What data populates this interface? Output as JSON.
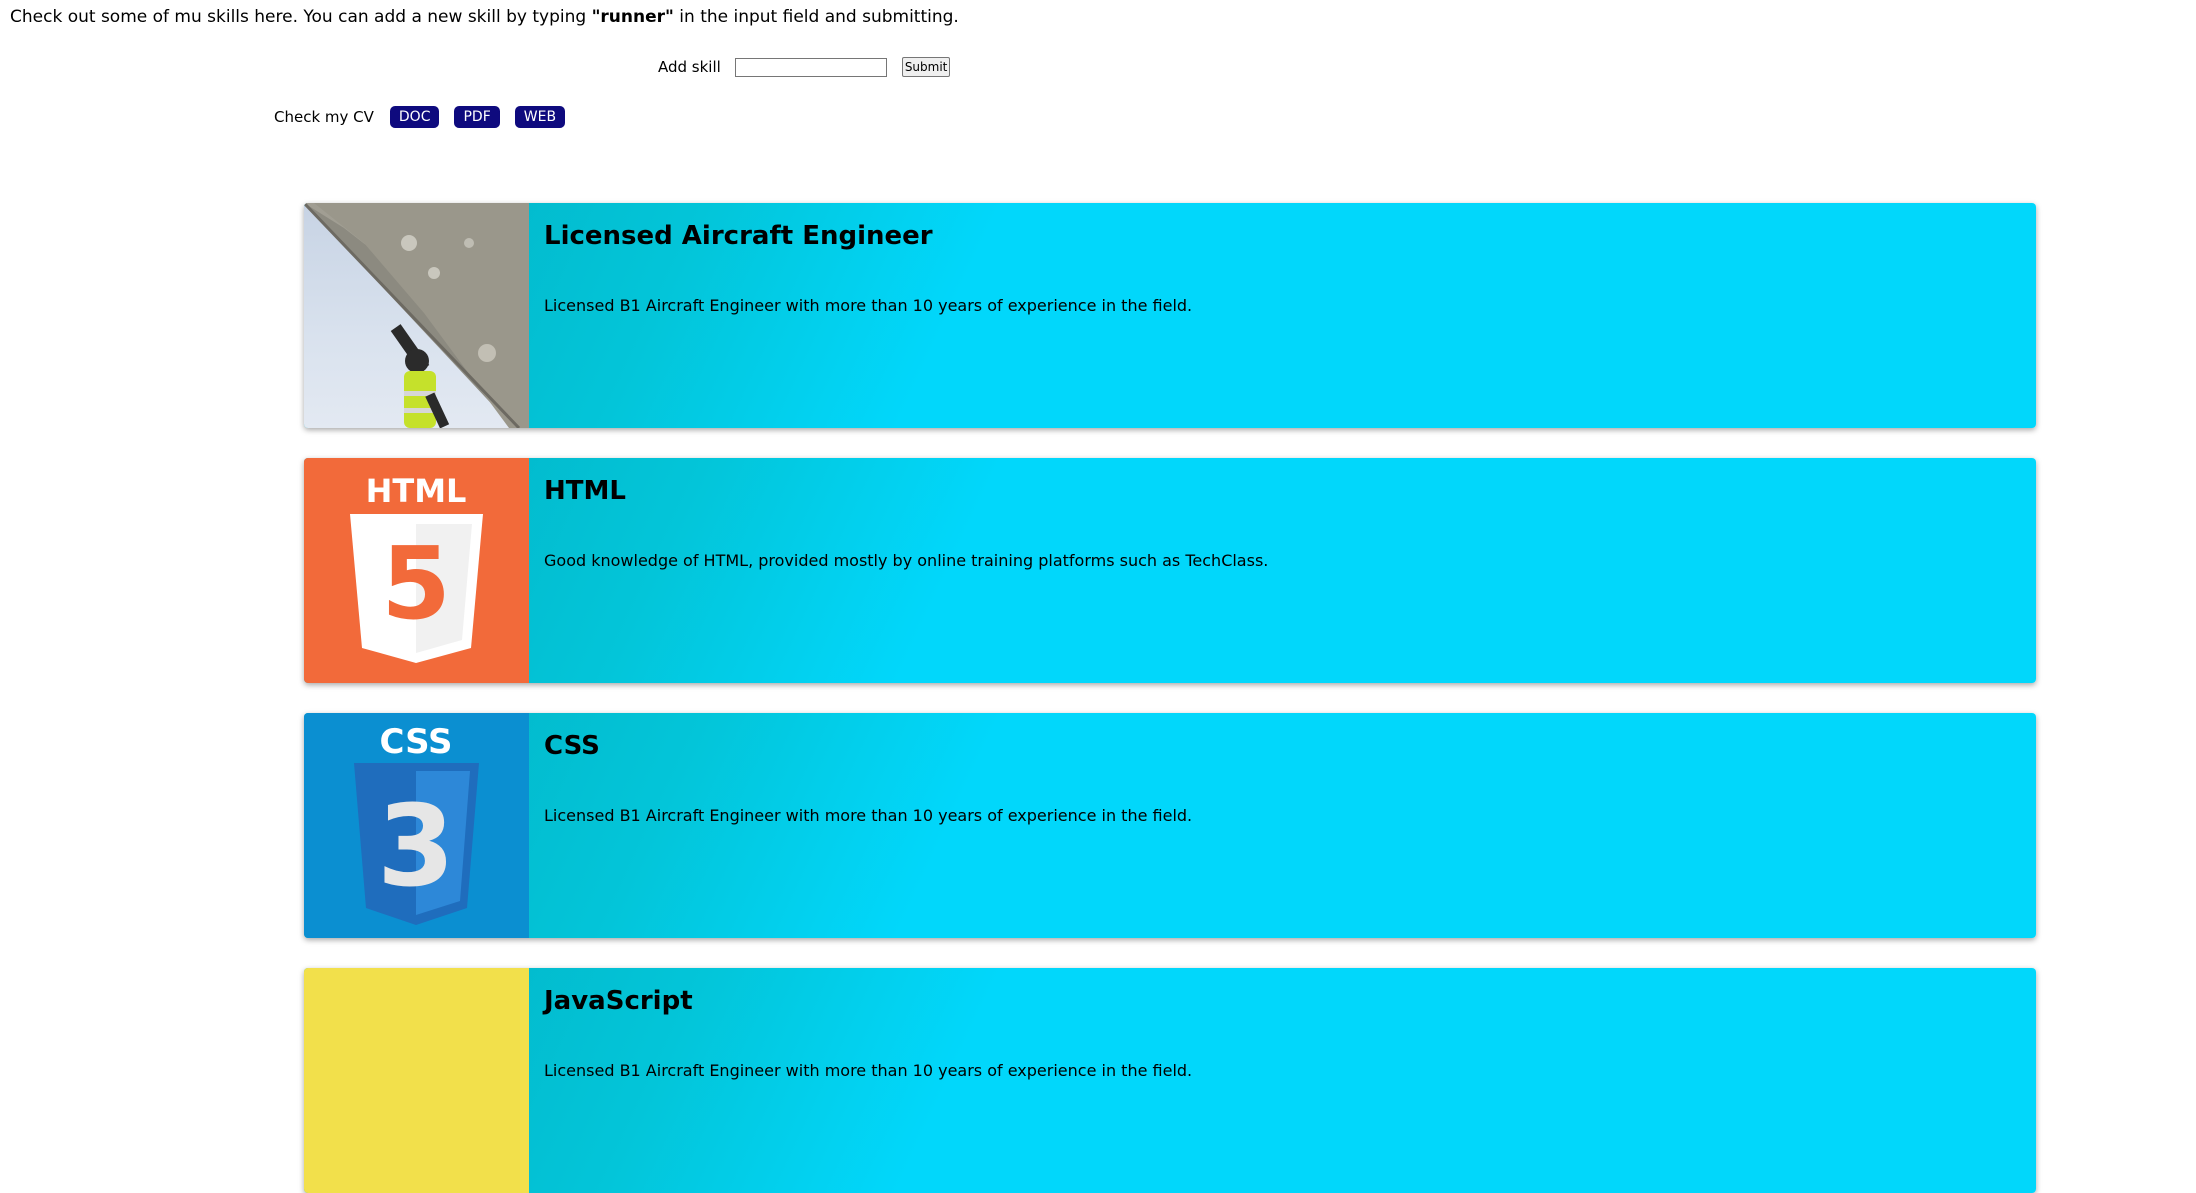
{
  "intro": {
    "before": "Check out some of mu skills here. You can add a new skill by typing ",
    "keyword": "\"runner\"",
    "after": " in the input field and submitting."
  },
  "add_skill": {
    "label": "Add skill",
    "input_value": "",
    "submit_label": "Submit"
  },
  "cv": {
    "label": "Check my CV",
    "buttons": [
      "DOC",
      "PDF",
      "WEB"
    ],
    "button_color": "#0e0a7e"
  },
  "colors": {
    "card_gradient_start": "#02b1c2",
    "card_gradient_end": "#01d7fb"
  },
  "skills": [
    {
      "title": "Licensed Aircraft Engineer",
      "description": "Licensed B1 Aircraft Engineer with more than 10 years of experience in the field.",
      "image": "aircraft-engineer-photo"
    },
    {
      "title": "HTML",
      "description": "Good knowledge of HTML, provided mostly by online training platforms such as TechClass.",
      "image": "html5-logo",
      "logo_text": "HTML",
      "logo_digit": "5"
    },
    {
      "title": "CSS",
      "description": "Licensed B1 Aircraft Engineer with more than 10 years of experience in the field.",
      "image": "css3-logo",
      "logo_text": "CSS",
      "logo_digit": "3"
    },
    {
      "title": "JavaScript",
      "description": "Licensed B1 Aircraft Engineer with more than 10 years of experience in the field.",
      "image": "javascript-logo"
    }
  ]
}
